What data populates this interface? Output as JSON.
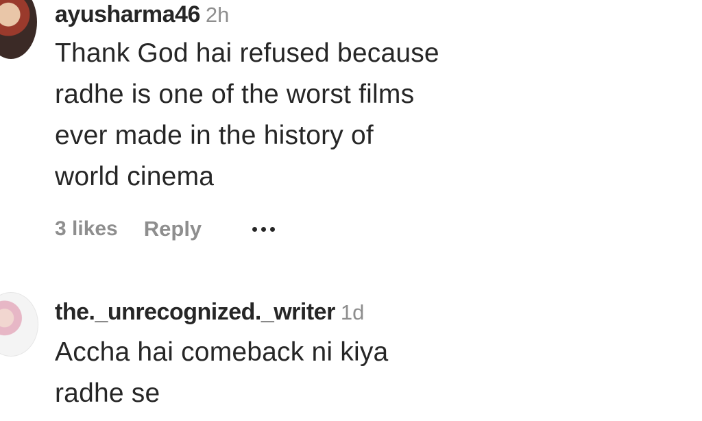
{
  "comments": [
    {
      "username": "ayusharma46",
      "time": "2h",
      "text_lines": [
        "Thank God hai refused because",
        "radhe is one of the worst films",
        "ever made in the history of",
        "world cinema"
      ],
      "likes": "3 likes",
      "reply_label": "Reply",
      "more_icon": "ellipsis-icon"
    },
    {
      "username": "the._unrecognized._writer",
      "time": "1d",
      "text_lines": [
        "Accha hai comeback ni kiya",
        "radhe se"
      ]
    }
  ],
  "colors": {
    "primary_text": "#262626",
    "secondary_text": "#8e8e8e",
    "background": "#ffffff"
  }
}
